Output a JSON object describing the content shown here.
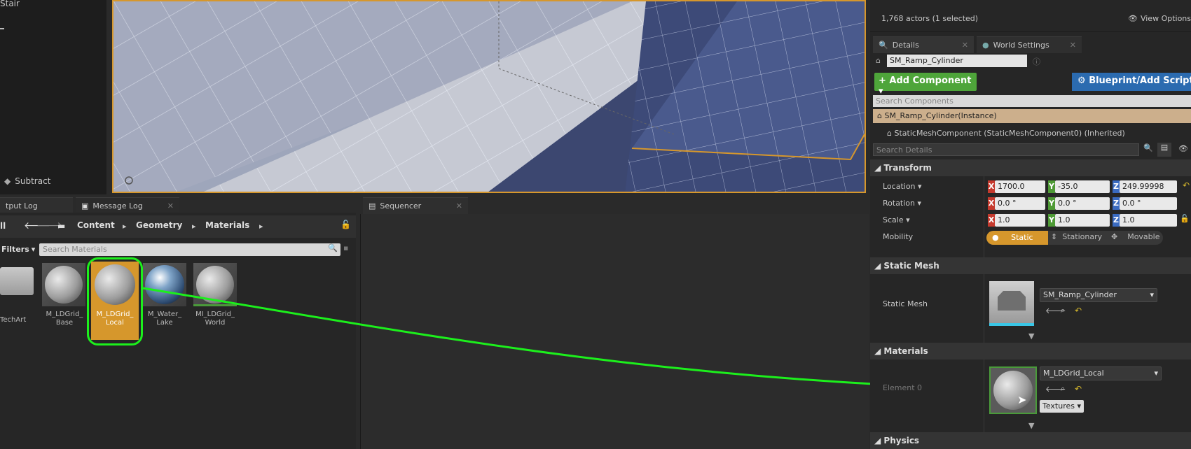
{
  "outliner": {
    "item_top": "Stair",
    "item_sub": "Subtract"
  },
  "tabs_bottom": [
    {
      "label": "tput Log"
    },
    {
      "label": "Message Log"
    },
    {
      "label": "Sequencer"
    }
  ],
  "content_browser": {
    "path": [
      "Content",
      "Geometry",
      "Materials"
    ],
    "filters_label": "Filters",
    "search_placeholder": "Search Materials",
    "left_truncated": "ll",
    "assets": [
      {
        "name_line1": "TechArt",
        "name_line2": ""
      },
      {
        "name_line1": "M_LDGrid_",
        "name_line2": "Base"
      },
      {
        "name_line1": "M_LDGrid_",
        "name_line2": "Local"
      },
      {
        "name_line1": "M_Water_",
        "name_line2": "Lake"
      },
      {
        "name_line1": "MI_LDGrid_",
        "name_line2": "World"
      }
    ]
  },
  "outliner_status": {
    "count": "1,768 actors (1 selected)",
    "view_options": "View Options"
  },
  "details": {
    "tabs": [
      {
        "label": "Details"
      },
      {
        "label": "World Settings"
      }
    ],
    "actor_name": "SM_Ramp_Cylinder",
    "add_component": "+ Add Component",
    "blueprint": "Blueprint/Add Script",
    "search_components": "Search Components",
    "instance": "SM_Ramp_Cylinder(Instance)",
    "component": "StaticMeshComponent (StaticMeshComponent0) (Inherited)",
    "search_details": "Search Details",
    "transform": {
      "header": "Transform",
      "location_label": "Location",
      "rotation_label": "Rotation",
      "scale_label": "Scale",
      "mobility_label": "Mobility",
      "location": {
        "x": "1700.0",
        "y": "-35.0",
        "z": "249.99998"
      },
      "rotation": {
        "x": "0.0 °",
        "y": "0.0 °",
        "z": "0.0 °"
      },
      "scale": {
        "x": "1.0",
        "y": "1.0",
        "z": "1.0"
      },
      "mobility": {
        "static": "Static",
        "stationary": "Stationary",
        "movable": "Movable"
      }
    },
    "static_mesh": {
      "header": "Static Mesh",
      "label": "Static Mesh",
      "value": "SM_Ramp_Cylinder"
    },
    "materials": {
      "header": "Materials",
      "element_label": "Element 0",
      "value": "M_LDGrid_Local",
      "textures": "Textures"
    },
    "physics": {
      "header": "Physics"
    }
  },
  "colors": {
    "accent_orange": "#d6972c",
    "annotation_green": "#1cf01c",
    "add_green": "#4ea53a",
    "blueprint_blue": "#2b6bb0"
  }
}
